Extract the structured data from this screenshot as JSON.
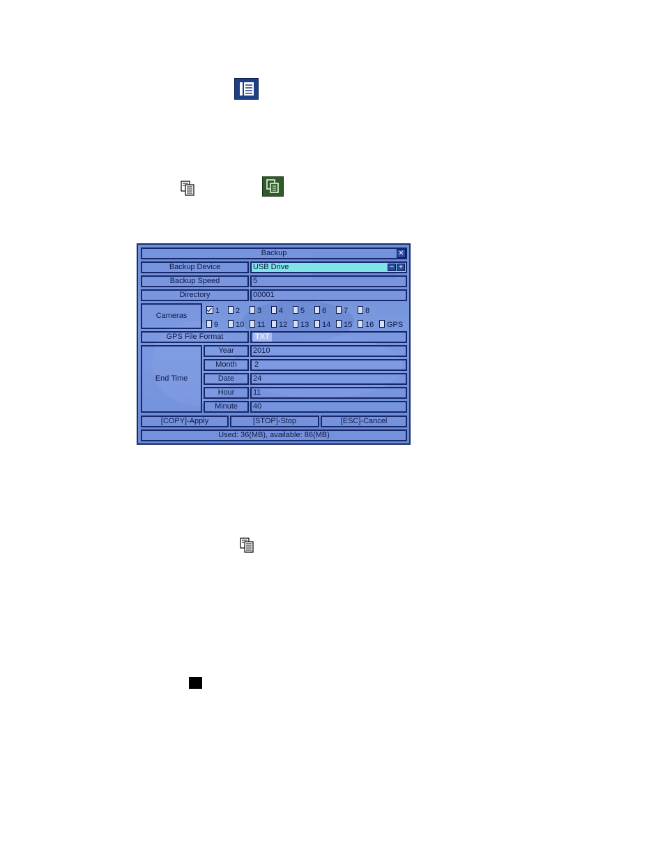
{
  "page_icons": {
    "menu": "menu-icon",
    "copy": "copy-icon",
    "backup_button": "backup-icon",
    "stop": "stop-icon"
  },
  "dialog": {
    "title": "Backup",
    "close_icon": "close-icon",
    "backup_device": {
      "label": "Backup Device",
      "value": "USB Drive"
    },
    "backup_speed": {
      "label": "Backup Speed",
      "value": "5"
    },
    "directory": {
      "label": "Directory",
      "value": "00001"
    },
    "cameras": {
      "label": "Cameras",
      "items": [
        {
          "label": "1",
          "checked": true
        },
        {
          "label": "2",
          "checked": false
        },
        {
          "label": "3",
          "checked": false
        },
        {
          "label": "4",
          "checked": false
        },
        {
          "label": "5",
          "checked": false
        },
        {
          "label": "6",
          "checked": false
        },
        {
          "label": "7",
          "checked": false
        },
        {
          "label": "8",
          "checked": false
        },
        {
          "label": "9",
          "checked": false
        },
        {
          "label": "10",
          "checked": false
        },
        {
          "label": "11",
          "checked": false
        },
        {
          "label": "12",
          "checked": false
        },
        {
          "label": "13",
          "checked": false
        },
        {
          "label": "14",
          "checked": false
        },
        {
          "label": "15",
          "checked": false
        },
        {
          "label": "16",
          "checked": false
        },
        {
          "label": "GPS",
          "checked": false
        }
      ]
    },
    "gps_file_format": {
      "label": "GPS File Format",
      "value": "TXT"
    },
    "end_time": {
      "label": "End Time",
      "year": {
        "label": "Year",
        "value": "2010"
      },
      "month": {
        "label": "Month",
        "value": "2"
      },
      "date": {
        "label": "Date",
        "value": "24"
      },
      "hour": {
        "label": "Hour",
        "value": "11"
      },
      "minute": {
        "label": "Minute",
        "value": "40"
      }
    },
    "buttons": {
      "apply": "[COPY]-Apply",
      "stop": "[STOP]-Stop",
      "cancel": "[ESC]-Cancel"
    },
    "status": "Used: 36(MB), available: 86(MB)",
    "colors": {
      "frame": "#16286a",
      "background": "#7b9ae0",
      "highlight": "#7fe3e8"
    }
  }
}
